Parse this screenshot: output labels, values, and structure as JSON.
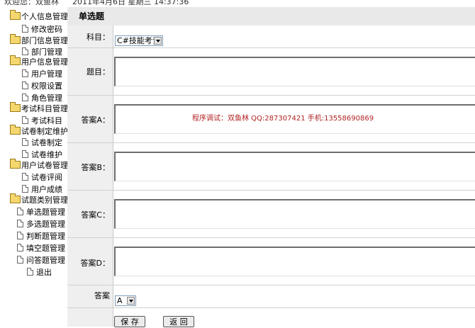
{
  "header": {
    "left_text": "欢迎您：双鱼林",
    "datetime_text": "2011年4月6日 星期三   14:37:36"
  },
  "sidebar": {
    "items": [
      {
        "label": "个人信息管理",
        "type": "folder"
      },
      {
        "label": "修改密码",
        "type": "doc"
      },
      {
        "label": "部门信息管理",
        "type": "folder"
      },
      {
        "label": "部门管理",
        "type": "doc"
      },
      {
        "label": "用户信息管理",
        "type": "folder"
      },
      {
        "label": "用户管理",
        "type": "doc"
      },
      {
        "label": "权限设置",
        "type": "doc"
      },
      {
        "label": "角色管理",
        "type": "doc"
      },
      {
        "label": "考试科目管理",
        "type": "folder"
      },
      {
        "label": "考试科目",
        "type": "doc"
      },
      {
        "label": "试卷制定维护",
        "type": "folder"
      },
      {
        "label": "试卷制定",
        "type": "doc"
      },
      {
        "label": "试卷维护",
        "type": "doc"
      },
      {
        "label": "用户试卷管理",
        "type": "folder"
      },
      {
        "label": "试卷评阅",
        "type": "doc"
      },
      {
        "label": "用户成绩",
        "type": "doc"
      },
      {
        "label": "试题类别管理",
        "type": "folder"
      },
      {
        "label": "单选题管理",
        "type": "doc"
      },
      {
        "label": "多选题管理",
        "type": "doc"
      },
      {
        "label": "判断题管理",
        "type": "doc"
      },
      {
        "label": "填空题管理",
        "type": "doc"
      },
      {
        "label": "问答题管理",
        "type": "doc"
      },
      {
        "label": "退出",
        "type": "doc"
      }
    ]
  },
  "page": {
    "title": "单选题",
    "subject_label": "科目：",
    "subject_value": "C#技能考试",
    "question_label": "题目：",
    "answer_a_label": "答案A：",
    "answer_b_label": "答案B：",
    "answer_c_label": "答案C：",
    "answer_d_label": "答案D：",
    "answer_label": "答案",
    "answer_value": "A",
    "save_button": "保 存",
    "back_button": "返 回",
    "watermark": "程序调试：双鱼林 QQ:287307421 手机:13558690869"
  },
  "colors": {
    "label_column_bg": "#efefef",
    "title_bar_bg": "#e9e9e9",
    "watermark_red": "#b22222",
    "folder_yellow": "#f5d76e"
  }
}
